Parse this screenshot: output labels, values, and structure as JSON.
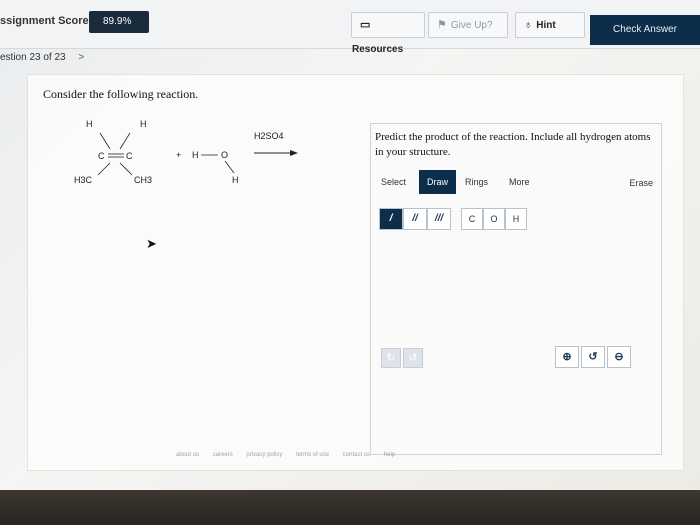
{
  "header": {
    "score_label": "ssignment Score:",
    "score_value": "89.9%",
    "resources": "Resources",
    "give_up": "Give Up?",
    "hint": "Hint",
    "check_answer": "Check Answer"
  },
  "question_nav": {
    "label": "estion 23 of 23",
    "next": ">"
  },
  "prompt": "Consider the following reaction.",
  "reaction": {
    "reactant1_atoms": [
      "H",
      "H",
      "C",
      "C",
      "H3C",
      "CH3"
    ],
    "plus": "+",
    "reactant2": {
      "h": "H",
      "o": "O",
      "h2": "H"
    },
    "reagent": "H2SO4"
  },
  "panel": {
    "instructions": "Predict the product of the reaction. Include all hydrogen atoms in your structure.",
    "tabs": [
      "Select",
      "Draw",
      "Rings",
      "More"
    ],
    "active_tab": "Draw",
    "erase": "Erase",
    "bonds": [
      "/",
      "//",
      "///"
    ],
    "atoms": [
      "C",
      "O",
      "H"
    ],
    "undo": "↻",
    "redo": "↺",
    "zoom_in": "⊕",
    "reset": "↺",
    "zoom_out": "⊖"
  },
  "footer": [
    "about us",
    "careers",
    "privacy policy",
    "terms of use",
    "contact us",
    "help"
  ],
  "colors": {
    "dark_navy": "#0d2e4a",
    "muted": "#8a9aa8"
  }
}
